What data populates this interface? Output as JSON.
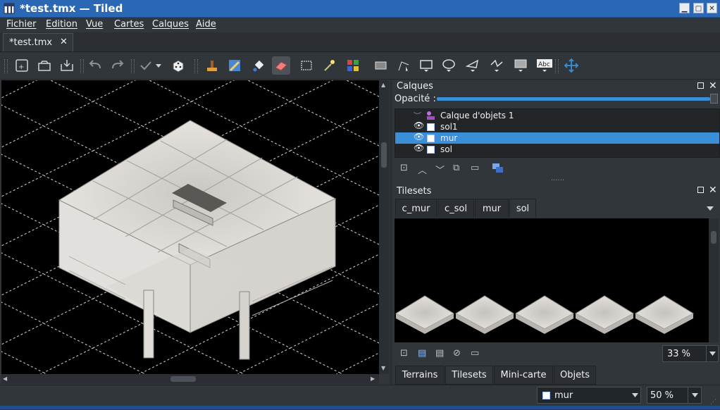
{
  "window": {
    "title": "*test.tmx — Tiled",
    "controls": [
      "minimize",
      "maximize",
      "close"
    ]
  },
  "menu": [
    "Fichier",
    "Edition",
    "Vue",
    "Cartes",
    "Calques",
    "Aide"
  ],
  "document_tab": {
    "label": "*test.tmx",
    "close": "✕"
  },
  "toolbar": {
    "icons": [
      "new-map-icon",
      "open-icon",
      "save-icon",
      "undo-icon",
      "redo-icon",
      "commit-check-icon",
      "dropdown-arrow-icon",
      "random-dice-icon",
      "stamp-brush-icon",
      "terrain-brush-icon",
      "bucket-fill-icon",
      "eraser-icon",
      "rectangle-select-icon",
      "magic-wand-icon",
      "select-same-tile-icon",
      "select-objects-icon",
      "edit-polygons-icon",
      "insert-rectangle-icon",
      "insert-ellipse-icon",
      "insert-polygon-icon",
      "insert-polyline-icon",
      "insert-tile-icon",
      "insert-text-icon",
      "move-icon"
    ]
  },
  "layers_panel": {
    "title": "Calques",
    "opacity_label": "Opacité :",
    "opacity": 1.0,
    "layers": [
      {
        "name": "Calque d'objets 1",
        "type": "object",
        "visible": false,
        "selected": false
      },
      {
        "name": "sol1",
        "type": "tile",
        "visible": true,
        "selected": false
      },
      {
        "name": "mur",
        "type": "tile",
        "visible": true,
        "selected": true
      },
      {
        "name": "sol",
        "type": "tile",
        "visible": true,
        "selected": false
      }
    ],
    "actions": [
      "new-layer-icon",
      "raise-layer-icon",
      "lower-layer-icon",
      "duplicate-layer-icon",
      "delete-layer-icon",
      "show-hide-others-icon"
    ],
    "splitter": "......"
  },
  "tilesets_panel": {
    "title": "Tilesets",
    "tabs": [
      "c_mur",
      "c_sol",
      "mur",
      "sol"
    ],
    "active_tab": "sol",
    "tiles_visible": 5,
    "zoom": "33 %",
    "actions": [
      "new-tileset-icon",
      "import-tileset-icon",
      "export-tileset-icon",
      "edit-tileset-icon",
      "remove-tileset-icon"
    ]
  },
  "bottom_tabs": [
    "Terrains",
    "Tilesets",
    "Mini-carte",
    "Objets"
  ],
  "active_bottom_tab": "Tilesets",
  "statusbar": {
    "layer_select": "mur",
    "zoom": "50 %"
  },
  "colors": {
    "titlebar": "#2a68b5",
    "selection": "#3b8ed8",
    "panel_bg": "#31363b",
    "canvas_bg": "#000000"
  }
}
